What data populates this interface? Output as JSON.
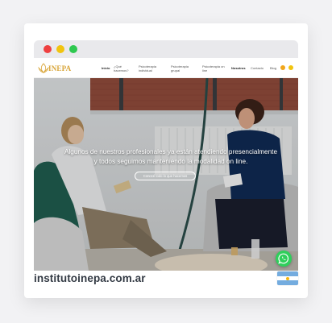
{
  "site": {
    "logo_text": "INEPA",
    "domain": "institutoinepa.com.ar"
  },
  "nav": {
    "items": [
      {
        "label": "Inicio"
      },
      {
        "label": "¿Qué hacemos?"
      },
      {
        "label": "Psicoterapia individual"
      },
      {
        "label": "Psicoterapia grupal"
      },
      {
        "label": "Psicoterapia on line"
      },
      {
        "label": "Nosotros"
      },
      {
        "label": "Contacto"
      },
      {
        "label": "Blog"
      }
    ]
  },
  "hero": {
    "line1": "Algunos de nuestros profesionales ya están atendiendo presencialmente",
    "line2": "y todos seguimos manteniendo la modalidad on line.",
    "button_label": "Conocé todo lo que hacemos"
  },
  "colors": {
    "brand_gold": "#d9a63a",
    "whatsapp_green": "#2fcf5b",
    "flag_blue": "#74acdf",
    "flag_sun": "#f6b40e"
  },
  "icons": {
    "window_controls": [
      "close-dot",
      "minimize-dot",
      "maximize-dot"
    ],
    "social": [
      "instagram-icon",
      "facebook-icon"
    ],
    "float": "whatsapp-icon",
    "country": "argentina-flag-icon"
  }
}
